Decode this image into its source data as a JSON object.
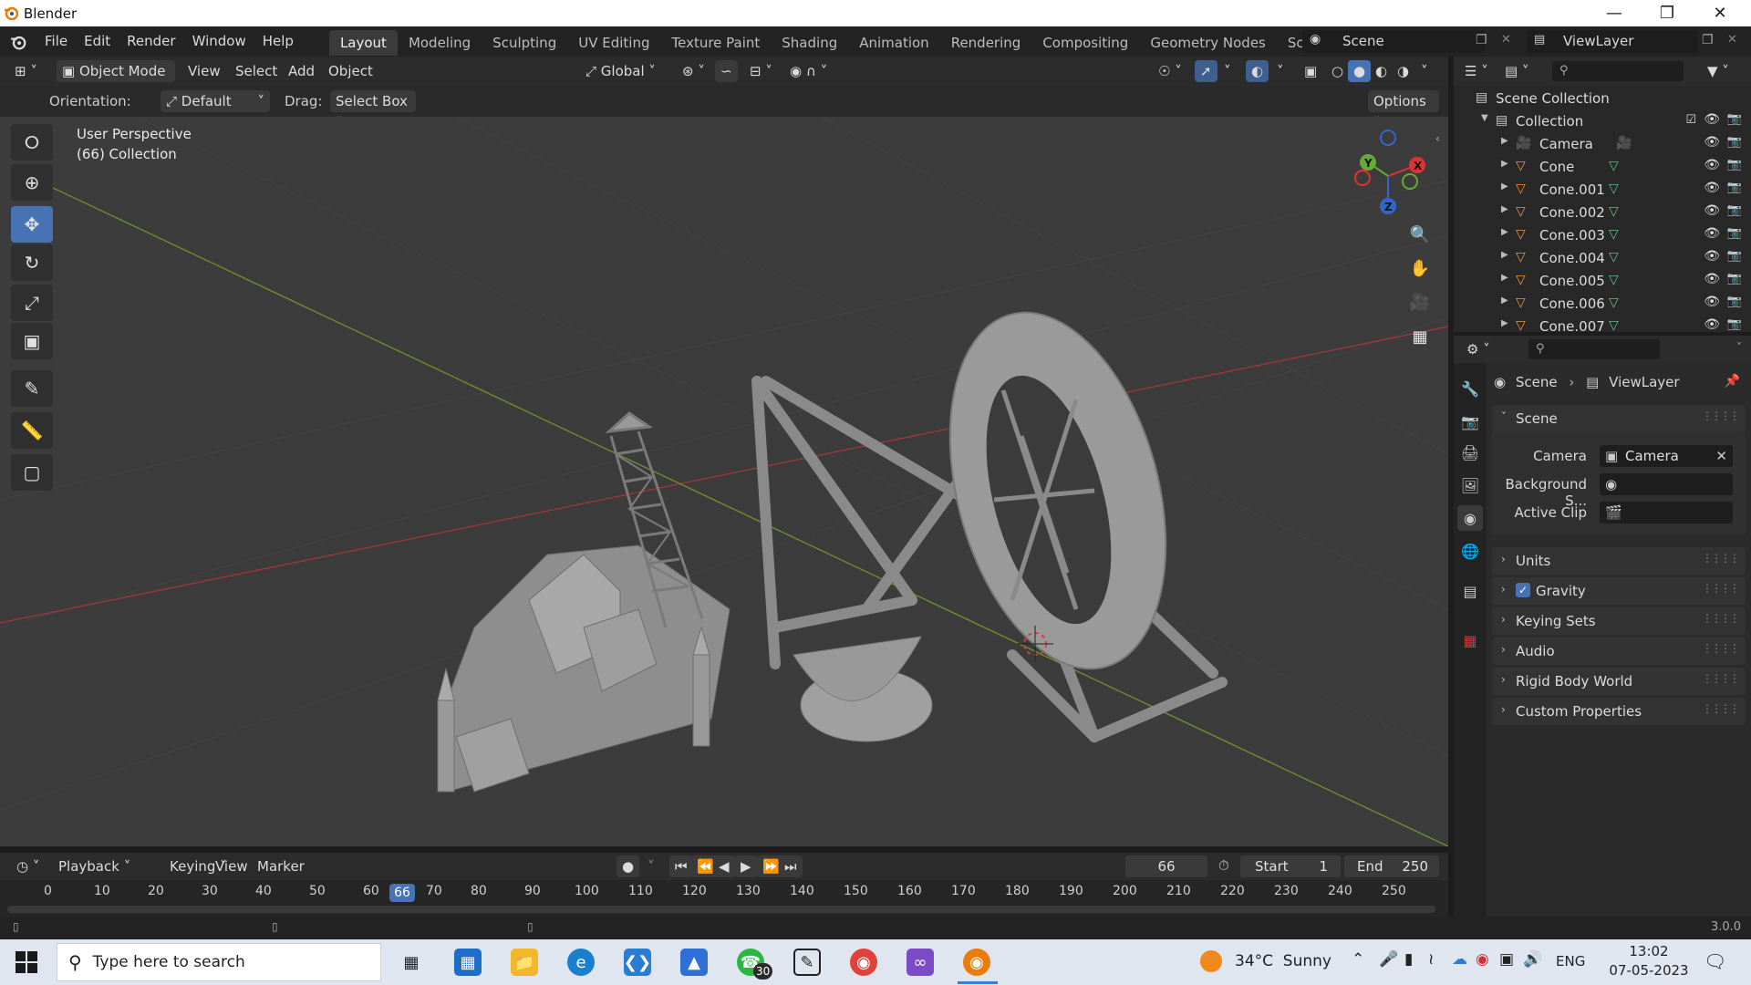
{
  "window": {
    "title": "Blender"
  },
  "menus": [
    "File",
    "Edit",
    "Render",
    "Window",
    "Help"
  ],
  "workspaces": [
    "Layout",
    "Modeling",
    "Sculpting",
    "UV Editing",
    "Texture Paint",
    "Shading",
    "Animation",
    "Rendering",
    "Compositing",
    "Geometry Nodes",
    "Scripting"
  ],
  "active_workspace": "Layout",
  "scene_field": "Scene",
  "viewlayer_field": "ViewLayer",
  "header3d": {
    "mode": "Object Mode",
    "view": "View",
    "select": "Select",
    "add": "Add",
    "object": "Object",
    "transform": "Global"
  },
  "toolhdr": {
    "orientation_label": "Orientation:",
    "orientation_value": "Default",
    "drag_label": "Drag:",
    "drag_value": "Select Box",
    "options": "Options"
  },
  "viewport": {
    "perspective": "User Perspective",
    "collection": "(66) Collection"
  },
  "gizmo": {
    "x": "X",
    "y": "Y",
    "z": "Z"
  },
  "timeline": {
    "playback": "Playback",
    "keying": "Keying",
    "view": "View",
    "marker": "Marker",
    "current_frame": "66",
    "start_label": "Start",
    "start": "1",
    "end_label": "End",
    "end": "250",
    "ticks": [
      "0",
      "10",
      "20",
      "30",
      "40",
      "50",
      "60",
      "70",
      "80",
      "90",
      "100",
      "110",
      "120",
      "130",
      "140",
      "150",
      "160",
      "170",
      "180",
      "190",
      "200",
      "210",
      "220",
      "230",
      "240",
      "250"
    ]
  },
  "version": "3.0.0",
  "outliner": {
    "scene_collection": "Scene Collection",
    "collection": "Collection",
    "items": [
      "Camera",
      "Cone",
      "Cone.001",
      "Cone.002",
      "Cone.003",
      "Cone.004",
      "Cone.005",
      "Cone.006",
      "Cone.007"
    ]
  },
  "properties": {
    "breadcrumb_scene": "Scene",
    "breadcrumb_viewlayer": "ViewLayer",
    "scene_panel": "Scene",
    "camera_label": "Camera",
    "camera_value": "Camera",
    "background_label": "Background S...",
    "active_clip_label": "Active Clip",
    "panels": [
      "Units",
      "Gravity",
      "Keying Sets",
      "Audio",
      "Rigid Body World",
      "Custom Properties"
    ]
  },
  "taskbar": {
    "search_placeholder": "Type here to search",
    "whatsapp_badge": "30",
    "weather": "34°C  Sunny",
    "lang": "ENG",
    "time": "13:02",
    "date": "07-05-2023"
  },
  "colors": {
    "accent": "#4772b3",
    "object_orange": "#f19236",
    "axis_red": "#b33a3a",
    "axis_green": "#6c9a2a"
  }
}
